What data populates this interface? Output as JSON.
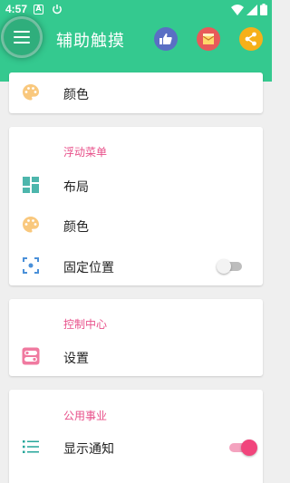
{
  "status_bar": {
    "time": "4:57",
    "a_icon": "A"
  },
  "header": {
    "title": "辅助触摸",
    "menu_icon": "hamburger-icon",
    "actions": [
      {
        "name": "like-button",
        "color": "#5a6fc4"
      },
      {
        "name": "mail-button",
        "color": "#e85a5a"
      },
      {
        "name": "share-button",
        "color": "#f6b01a"
      }
    ],
    "color": "#34c98f"
  },
  "section0": {
    "color_label": "颜色"
  },
  "floating_menu": {
    "title": "浮动菜单",
    "items": {
      "layout": "布局",
      "color": "颜色",
      "fixed_position": "固定位置"
    },
    "fixed_position_enabled": false
  },
  "control_center": {
    "title": "控制中心",
    "settings": "设置"
  },
  "utilities": {
    "title": "公用事业",
    "show_notification": "显示通知",
    "show_notification_enabled": true
  },
  "accent_color": "#e8508a"
}
